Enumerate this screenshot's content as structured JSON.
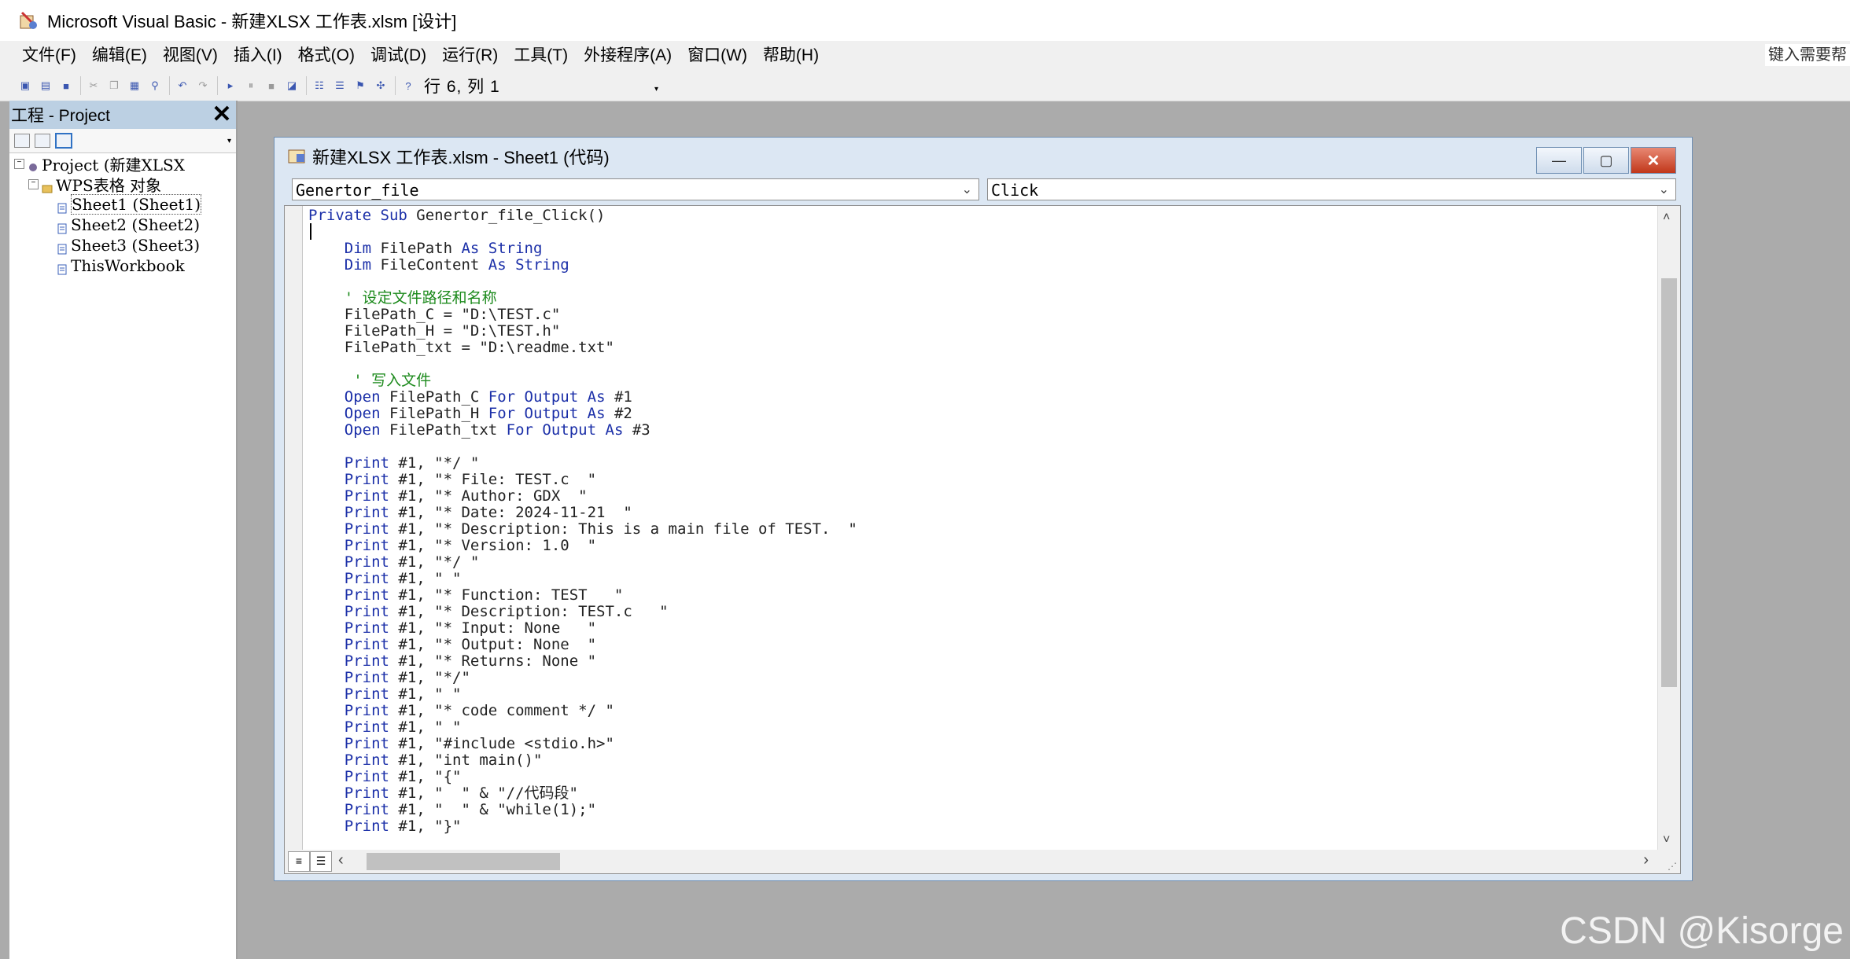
{
  "window": {
    "title": "Microsoft Visual Basic - 新建XLSX 工作表.xlsm [设计]"
  },
  "menu": {
    "items": [
      "文件(F)",
      "编辑(E)",
      "视图(V)",
      "插入(I)",
      "格式(O)",
      "调试(D)",
      "运行(R)",
      "工具(T)",
      "外接程序(A)",
      "窗口(W)",
      "帮助(H)"
    ],
    "help_box": "键入需要帮"
  },
  "toolbar": {
    "position_text": "行 6, 列 1"
  },
  "project": {
    "title": "工程 - Project",
    "tree": {
      "root": "Project (新建XLSX",
      "folder": "WPS表格 对象",
      "items": [
        "Sheet1 (Sheet1)",
        "Sheet2 (Sheet2)",
        "Sheet3 (Sheet3)",
        "ThisWorkbook"
      ]
    }
  },
  "code_window": {
    "title": "新建XLSX 工作表.xlsm - Sheet1 (代码)",
    "object_combo": "Genertor_file",
    "proc_combo": "Click"
  },
  "code_lines": [
    [
      {
        "t": "Private Sub ",
        "c": "kw"
      },
      {
        "t": "Genertor_file_Click()",
        "c": ""
      }
    ],
    [],
    [
      {
        "t": "    Dim ",
        "c": "kw"
      },
      {
        "t": "FilePath ",
        "c": ""
      },
      {
        "t": "As String",
        "c": "kw"
      }
    ],
    [
      {
        "t": "    Dim ",
        "c": "kw"
      },
      {
        "t": "FileContent ",
        "c": ""
      },
      {
        "t": "As String",
        "c": "kw"
      }
    ],
    [],
    [
      {
        "t": "    ' 设定文件路径和名称",
        "c": "cm"
      }
    ],
    [
      {
        "t": "    FilePath_C = \"D:\\TEST.c\"",
        "c": ""
      }
    ],
    [
      {
        "t": "    FilePath_H = \"D:\\TEST.h\"",
        "c": ""
      }
    ],
    [
      {
        "t": "    FilePath_txt = \"D:\\readme.txt\"",
        "c": ""
      }
    ],
    [],
    [
      {
        "t": "     ' 写入文件",
        "c": "cm"
      }
    ],
    [
      {
        "t": "    Open ",
        "c": "kw"
      },
      {
        "t": "FilePath_C ",
        "c": ""
      },
      {
        "t": "For Output As ",
        "c": "kw"
      },
      {
        "t": "#1",
        "c": ""
      }
    ],
    [
      {
        "t": "    Open ",
        "c": "kw"
      },
      {
        "t": "FilePath_H ",
        "c": ""
      },
      {
        "t": "For Output As ",
        "c": "kw"
      },
      {
        "t": "#2",
        "c": ""
      }
    ],
    [
      {
        "t": "    Open ",
        "c": "kw"
      },
      {
        "t": "FilePath_txt ",
        "c": ""
      },
      {
        "t": "For Output As ",
        "c": "kw"
      },
      {
        "t": "#3",
        "c": ""
      }
    ],
    [],
    [
      {
        "t": "    Print ",
        "c": "kw"
      },
      {
        "t": "#1, \"*/ \"",
        "c": ""
      }
    ],
    [
      {
        "t": "    Print ",
        "c": "kw"
      },
      {
        "t": "#1, \"* File: TEST.c  \"",
        "c": ""
      }
    ],
    [
      {
        "t": "    Print ",
        "c": "kw"
      },
      {
        "t": "#1, \"* Author: GDX  \"",
        "c": ""
      }
    ],
    [
      {
        "t": "    Print ",
        "c": "kw"
      },
      {
        "t": "#1, \"* Date: 2024-11-21  \"",
        "c": ""
      }
    ],
    [
      {
        "t": "    Print ",
        "c": "kw"
      },
      {
        "t": "#1, \"* Description: This is a main file of TEST.  \"",
        "c": ""
      }
    ],
    [
      {
        "t": "    Print ",
        "c": "kw"
      },
      {
        "t": "#1, \"* Version: 1.0  \"",
        "c": ""
      }
    ],
    [
      {
        "t": "    Print ",
        "c": "kw"
      },
      {
        "t": "#1, \"*/ \"",
        "c": ""
      }
    ],
    [
      {
        "t": "    Print ",
        "c": "kw"
      },
      {
        "t": "#1, \" \"",
        "c": ""
      }
    ],
    [
      {
        "t": "    Print ",
        "c": "kw"
      },
      {
        "t": "#1, \"* Function: TEST   \"",
        "c": ""
      }
    ],
    [
      {
        "t": "    Print ",
        "c": "kw"
      },
      {
        "t": "#1, \"* Description: TEST.c   \"",
        "c": ""
      }
    ],
    [
      {
        "t": "    Print ",
        "c": "kw"
      },
      {
        "t": "#1, \"* Input: None   \"",
        "c": ""
      }
    ],
    [
      {
        "t": "    Print ",
        "c": "kw"
      },
      {
        "t": "#1, \"* Output: None  \"",
        "c": ""
      }
    ],
    [
      {
        "t": "    Print ",
        "c": "kw"
      },
      {
        "t": "#1, \"* Returns: None \"",
        "c": ""
      }
    ],
    [
      {
        "t": "    Print ",
        "c": "kw"
      },
      {
        "t": "#1, \"*/\"",
        "c": ""
      }
    ],
    [
      {
        "t": "    Print ",
        "c": "kw"
      },
      {
        "t": "#1, \" \"",
        "c": ""
      }
    ],
    [
      {
        "t": "    Print ",
        "c": "kw"
      },
      {
        "t": "#1, \"* code comment */ \"",
        "c": ""
      }
    ],
    [
      {
        "t": "    Print ",
        "c": "kw"
      },
      {
        "t": "#1, \" \"",
        "c": ""
      }
    ],
    [
      {
        "t": "    Print ",
        "c": "kw"
      },
      {
        "t": "#1, \"#include <stdio.h>\"",
        "c": ""
      }
    ],
    [
      {
        "t": "    Print ",
        "c": "kw"
      },
      {
        "t": "#1, \"int main()\"",
        "c": ""
      }
    ],
    [
      {
        "t": "    Print ",
        "c": "kw"
      },
      {
        "t": "#1, \"{\"",
        "c": ""
      }
    ],
    [
      {
        "t": "    Print ",
        "c": "kw"
      },
      {
        "t": "#1, \"  \" & \"//代码段\"",
        "c": ""
      }
    ],
    [
      {
        "t": "    Print ",
        "c": "kw"
      },
      {
        "t": "#1, \"  \" & \"while(1);\"",
        "c": ""
      }
    ],
    [
      {
        "t": "    Print ",
        "c": "kw"
      },
      {
        "t": "#1, \"}\"",
        "c": ""
      }
    ]
  ],
  "watermark": "CSDN @Kisorge",
  "colors": {
    "keyword": "#1b2fa8",
    "comment": "#1c8a1c",
    "project_header": "#bcd0e3",
    "mdi_background": "#ababab"
  }
}
